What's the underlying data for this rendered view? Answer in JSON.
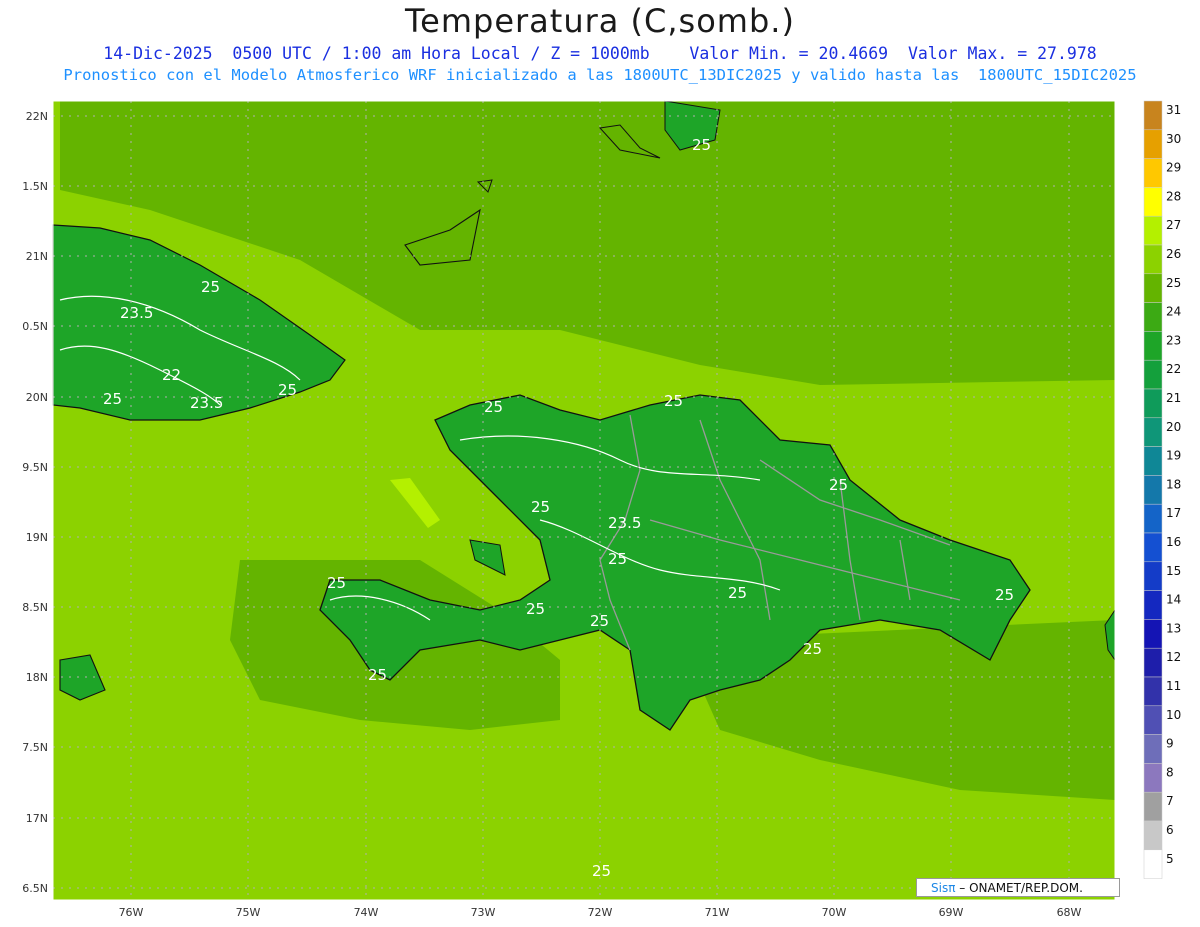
{
  "title": "Temperatura (C,somb.)",
  "subtitle_line1": "14-Dic-2025  0500 UTC / 1:00 am Hora Local / Z = 1000mb    Valor Min. = 20.4669  Valor Max. = 27.978",
  "subtitle_line2": "Pronostico con el Modelo Atmosferico WRF inicializado a las 1800UTC_13DIC2025 y valido hasta las  1800UTC_15DIC2025",
  "credit": {
    "sis": "Sisπ",
    "rest": " – ONAMET/REP.DOM."
  },
  "axes": {
    "lon_labels": [
      "76W",
      "75W",
      "74W",
      "73W",
      "72W",
      "71W",
      "70W",
      "69W",
      "68W"
    ],
    "lat_labels": [
      "22N",
      "1.5N",
      "21N",
      "0.5N",
      "20N",
      "9.5N",
      "19N",
      "8.5N",
      "18N",
      "7.5N",
      "17N",
      "6.5N"
    ]
  },
  "colorbar": {
    "levels": [
      "31",
      "30",
      "29",
      "28",
      "27",
      "26",
      "25",
      "24",
      "23",
      "22",
      "21",
      "20",
      "19",
      "18",
      "17",
      "16",
      "15",
      "14",
      "13",
      "12",
      "11",
      "10",
      "9",
      "8",
      "7",
      "6",
      "5"
    ],
    "colors": [
      "#c8841e",
      "#e6a000",
      "#ffc800",
      "#ffff00",
      "#b4f000",
      "#8cd200",
      "#64b400",
      "#3caa14",
      "#1ea528",
      "#14a03c",
      "#0f9b5a",
      "#0f9678",
      "#0f8796",
      "#1478aa",
      "#1464c8",
      "#1450d2",
      "#143cc8",
      "#1428c0",
      "#1414b4",
      "#1e1eaa",
      "#3232aa",
      "#5050b4",
      "#6e6eb9",
      "#8c78be",
      "#a0a0a0",
      "#c8c8c8",
      "#ffffff"
    ]
  },
  "contour_labels": [
    "25",
    "23.5",
    "25",
    "22",
    "25",
    "23.5",
    "25",
    "25",
    "25",
    "25",
    "23.5",
    "25",
    "25",
    "25",
    "25",
    "25",
    "25",
    "25",
    "25",
    "25",
    "25"
  ],
  "field_colors": {
    "sea": "#8cd200",
    "sea_warm": "#64b400",
    "land": "#1ea528",
    "land_cool": "#3caa14",
    "hot": "#b4f000"
  }
}
